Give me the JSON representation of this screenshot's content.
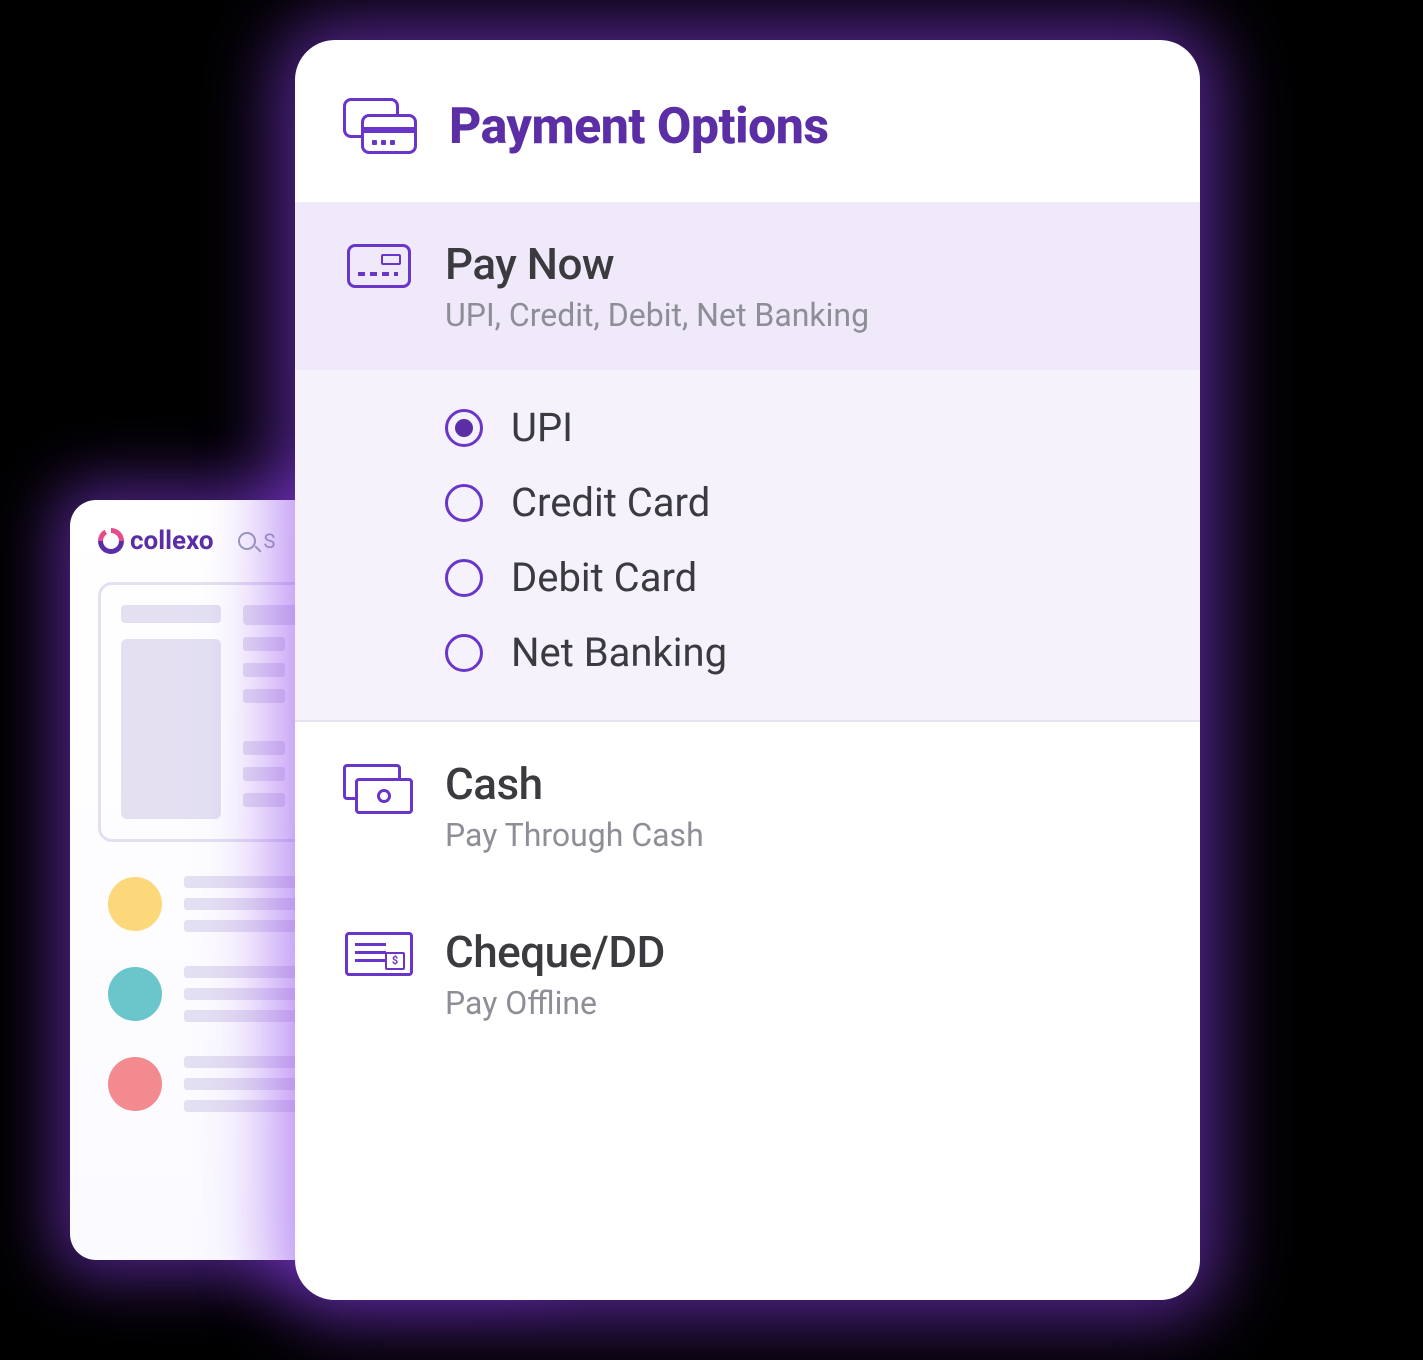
{
  "brand": {
    "name": "collexo"
  },
  "search": {
    "placeholder": "S"
  },
  "panel": {
    "title": "Payment Options",
    "pay_now": {
      "title": "Pay Now",
      "subtitle": "UPI, Credit, Debit, Net Banking"
    },
    "methods": {
      "upi": {
        "label": "UPI",
        "selected": true
      },
      "credit": {
        "label": "Credit Card",
        "selected": false
      },
      "debit": {
        "label": "Debit Card",
        "selected": false
      },
      "net": {
        "label": "Net Banking",
        "selected": false
      }
    },
    "cash": {
      "title": "Cash",
      "subtitle": "Pay Through Cash"
    },
    "cheque": {
      "title": "Cheque/DD",
      "subtitle": "Pay Offline"
    }
  }
}
